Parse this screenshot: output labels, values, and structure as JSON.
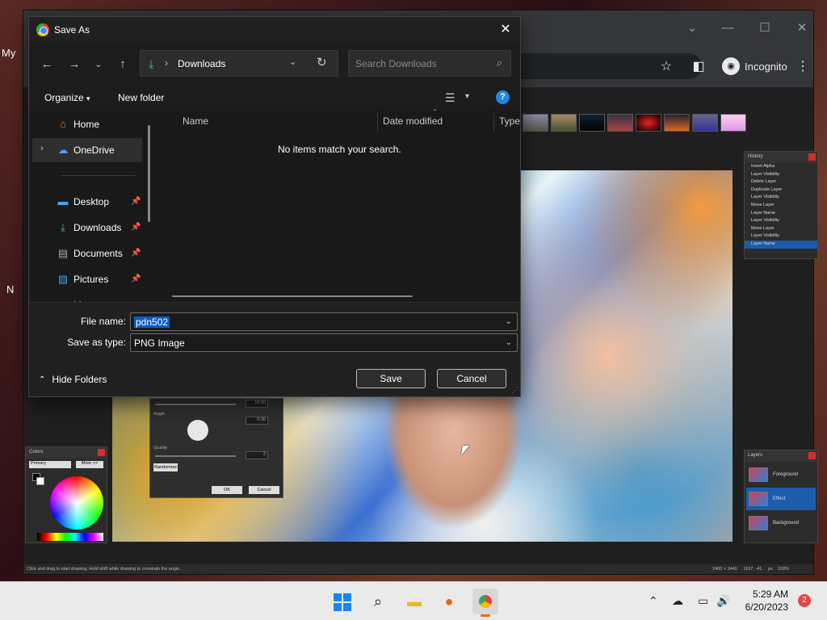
{
  "dialog": {
    "title": "Save As",
    "address": {
      "location": "Downloads"
    },
    "search": {
      "placeholder": "Search Downloads"
    },
    "commands": {
      "organize": "Organize",
      "new_folder": "New folder"
    },
    "nav_items": [
      {
        "label": "Home",
        "icon": "home-icon",
        "pinned": false
      },
      {
        "label": "OneDrive",
        "icon": "cloud-icon",
        "pinned": false
      },
      {
        "label": "Desktop",
        "icon": "desktop-icon",
        "pinned": true
      },
      {
        "label": "Downloads",
        "icon": "download-icon",
        "pinned": true
      },
      {
        "label": "Documents",
        "icon": "document-icon",
        "pinned": true
      },
      {
        "label": "Pictures",
        "icon": "pictures-icon",
        "pinned": true
      },
      {
        "label": "Mu",
        "icon": "music-icon",
        "pinned": false
      }
    ],
    "columns": [
      "Name",
      "Date modified",
      "Type"
    ],
    "empty_message": "No items match your search.",
    "file_name_label": "File name:",
    "file_name_value": "pdn502",
    "save_type_label": "Save as type:",
    "save_type_value": "PNG Image",
    "hide_folders": "Hide Folders",
    "save_button": "Save",
    "cancel_button": "Cancel"
  },
  "browser": {
    "incognito_label": "Incognito",
    "left_edge_text": "My",
    "left_edge_text2": "N"
  },
  "paintnet": {
    "history_title": "History",
    "history_items": [
      "Invert Alpha",
      "Layer Visibility",
      "Delete Layer",
      "Duplicate Layer",
      "Layer Visibility",
      "Move Layer",
      "Layer Name",
      "Layer Visibility",
      "Move Layer",
      "Layer Visibility",
      "Layer Name"
    ],
    "layers_title": "Layers",
    "layers": [
      "Foreground",
      "Effect",
      "Background"
    ],
    "colors_title": "Colors",
    "colors_primary": "Primary",
    "colors_more": "More >>",
    "effect": {
      "angle_label": "Angle",
      "quality_label": "Quality",
      "randomize": "Randomize",
      "ok": "OK",
      "cancel": "Cancel",
      "value1": "10.00",
      "value2": "0.00",
      "value3": "2"
    },
    "status_text": "Click and drag to start drawing. Hold shift while drawing to constrain the angle.",
    "image_size": "2400 × 1440",
    "cursor_pos": "1167, -41",
    "zoom": "100%",
    "unit": "px"
  },
  "taskbar": {
    "time": "5:29 AM",
    "date": "6/20/2023",
    "notifications": "2"
  },
  "colors": {
    "accent": "#1b5cab",
    "selection": "#0b5cc5",
    "downloads_green": "#4ec06a",
    "help_blue": "#1e88e5"
  }
}
